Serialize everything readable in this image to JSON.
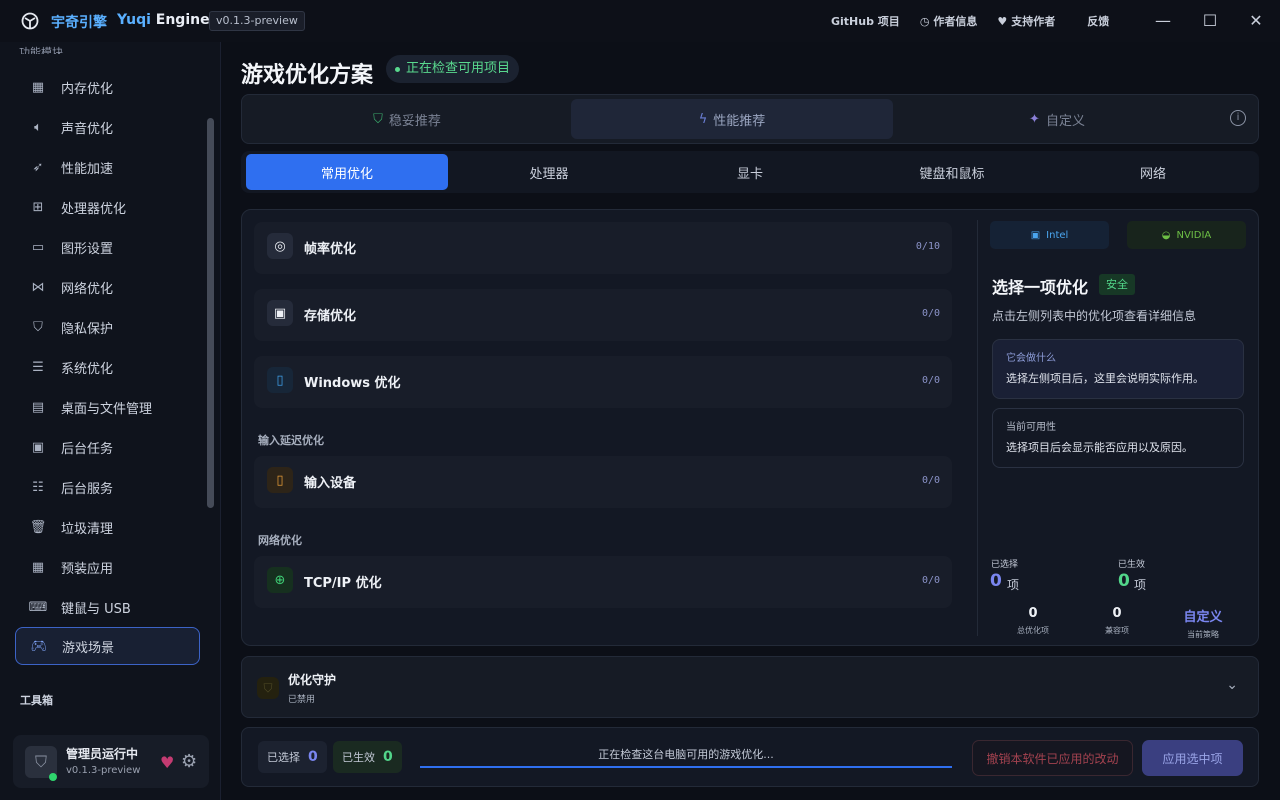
{
  "titlebar": {
    "app_name_cn": "宇奇引擎",
    "app_name_en_prefix": "Yuqi",
    "app_name_en_suffix": "Engine",
    "version": "v0.1.3-preview",
    "links": [
      "GitHub 项目",
      "作者信息",
      "支持作者",
      "反馈"
    ]
  },
  "sidebar": {
    "section_heading": "功能模块",
    "items": [
      {
        "label": "内存优化",
        "icon": "memory-icon"
      },
      {
        "label": "声音优化",
        "icon": "speaker-icon"
      },
      {
        "label": "性能加速",
        "icon": "rocket-icon"
      },
      {
        "label": "处理器优化",
        "icon": "cpu-icon"
      },
      {
        "label": "图形设置",
        "icon": "monitor-icon"
      },
      {
        "label": "网络优化",
        "icon": "network-icon"
      },
      {
        "label": "隐私保护",
        "icon": "shield-icon"
      },
      {
        "label": "系统优化",
        "icon": "sliders-icon"
      },
      {
        "label": "桌面与文件管理",
        "icon": "folder-icon"
      },
      {
        "label": "后台任务",
        "icon": "calendar-icon"
      },
      {
        "label": "后台服务",
        "icon": "server-icon"
      },
      {
        "label": "垃圾清理",
        "icon": "trash-icon"
      },
      {
        "label": "预装应用",
        "icon": "apps-grid-icon"
      },
      {
        "label": "键鼠与 USB",
        "icon": "usb-icon"
      },
      {
        "label": "游戏场景",
        "icon": "gamepad-icon"
      }
    ],
    "active_item": "游戏场景",
    "toolbox_heading": "工具箱",
    "user": {
      "name": "管理员运行中",
      "version": "v0.1.3-preview"
    }
  },
  "main": {
    "title": "游戏优化方案",
    "status": "正在检查可用项目",
    "modes": [
      "稳妥推荐",
      "性能推荐",
      "自定义"
    ],
    "selected_mode": "性能推荐",
    "tabs": [
      "常用优化",
      "处理器",
      "显卡",
      "键盘和鼠标",
      "网络"
    ],
    "selected_tab": "常用优化",
    "groups": [
      {
        "label": "帧率优化",
        "count": "0/10"
      },
      {
        "label": "存储优化",
        "count": "0/0"
      },
      {
        "label": "Windows 优化",
        "count": "0/0"
      },
      {
        "label": "输入设备",
        "count": "0/0"
      },
      {
        "label": "TCP/IP 优化",
        "count": "0/0"
      }
    ],
    "sections": [
      "输入延迟优化",
      "网络优化"
    ]
  },
  "detail": {
    "vendors": [
      "Intel",
      "NVIDIA"
    ],
    "title": "选择一项优化",
    "badge": "安全",
    "subtitle": "点击左侧列表中的优化项查看详细信息",
    "what_title": "它会做什么",
    "what_body": "选择左侧项目后，这里会说明实际作用。",
    "avail_title": "当前可用性",
    "avail_body": "选择项目后会显示能否应用以及原因。",
    "selected_label": "已选择",
    "selected_value": "0",
    "effective_label": "已生效",
    "effective_value": "0",
    "unit": "项",
    "total_value": "0",
    "total_label": "总优化项",
    "compat_value": "0",
    "compat_label": "兼容项",
    "strategy_value": "自定义",
    "strategy_label": "当前策略"
  },
  "guard": {
    "title": "优化守护",
    "status": "已禁用"
  },
  "bottom": {
    "selected_label": "已选择",
    "selected_value": "0",
    "effective_label": "已生效",
    "effective_value": "0",
    "progress_text": "正在检查这台电脑可用的游戏优化...",
    "revert_button": "撤销本软件已应用的改动",
    "apply_button": "应用选中项"
  },
  "colors": {
    "accent": "#2f6ff0",
    "success": "#52d68a",
    "danger": "#a3424f",
    "brand": "#5ab0ff"
  }
}
